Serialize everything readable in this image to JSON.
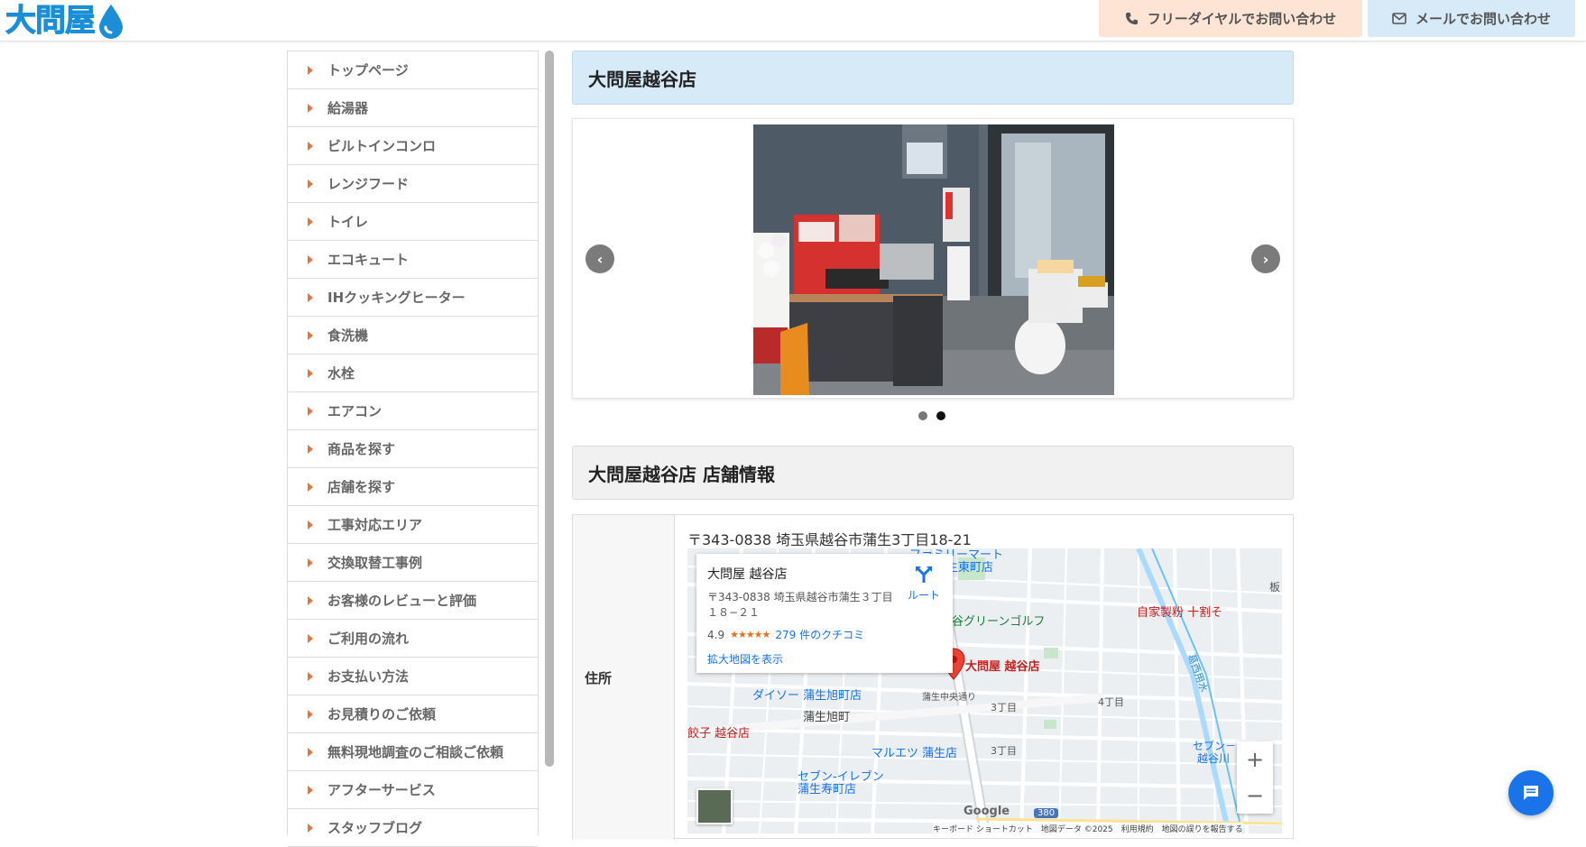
{
  "header": {
    "logo_text": "大問屋",
    "free_dial_label": "フリーダイヤルでお問い合わせ",
    "mail_label": "メールでお問い合わせ"
  },
  "sidebar": {
    "items": [
      {
        "label": "トップページ"
      },
      {
        "label": "給湯器"
      },
      {
        "label": "ビルトインコンロ"
      },
      {
        "label": "レンジフード"
      },
      {
        "label": "トイレ"
      },
      {
        "label": "エコキュート"
      },
      {
        "label": "IHクッキングヒーター"
      },
      {
        "label": "食洗機"
      },
      {
        "label": "水栓"
      },
      {
        "label": "エアコン"
      },
      {
        "label": "商品を探す"
      },
      {
        "label": "店舗を探す"
      },
      {
        "label": "工事対応エリア"
      },
      {
        "label": "交換取替工事例"
      },
      {
        "label": "お客様のレビューと評価"
      },
      {
        "label": "ご利用の流れ"
      },
      {
        "label": "お支払い方法"
      },
      {
        "label": "お見積りのご依頼"
      },
      {
        "label": "無料現地調査のご相談ご依頼"
      },
      {
        "label": "アフターサービス"
      },
      {
        "label": "スタッフブログ"
      }
    ]
  },
  "main": {
    "store_title": "大問屋越谷店",
    "slider": {
      "slide_count": 2,
      "active_slide": 2
    },
    "info_title": "大問屋越谷店 店舗情報",
    "address_label": "住所",
    "address": "〒343-0838 埼玉県越谷市蒲生3丁目18-21"
  },
  "map": {
    "card": {
      "name": "大問屋 越谷店",
      "address": "〒343-0838 埼玉県越谷市蒲生３丁目１８−２１",
      "rating": "4.9",
      "stars": "★★★★★",
      "reviews": "279 件のクチコミ",
      "enlarge": "拡大地図を表示",
      "route": "ルート"
    },
    "labels": {
      "store_pin": "大問屋 越谷店",
      "familymart": "ファミリーマート",
      "familymart_branch": "蒲生東町店",
      "golf": "越谷グリーンゴルフ",
      "jika": "自家製粉 十割そ",
      "daiso": "ダイソー 蒲生旭町店",
      "asahi": "蒲生旭町",
      "gyoza": "餃子 越谷店",
      "maruetsu": "マルエツ 蒲生店",
      "seven": "セブン-イレブン",
      "seven_branch": "蒲生寿町店",
      "chome3": "3丁目",
      "chome4": "4丁目",
      "road": "蒲生中央通り",
      "river": "葛西用水",
      "seven_right": "セブン－イ",
      "seven_right2": "越谷川",
      "edge": "板",
      "route_no": "380",
      "google": "Google",
      "footer": "キーボード ショートカット　地図データ ©2025　利用規約　地図の誤りを報告する"
    }
  },
  "colors": {
    "accent_orange": "#e8743b",
    "title_blue_bg": "#d6eaf8",
    "free_dial_bg": "#fde4d4",
    "chat_blue": "#1a73e8"
  }
}
